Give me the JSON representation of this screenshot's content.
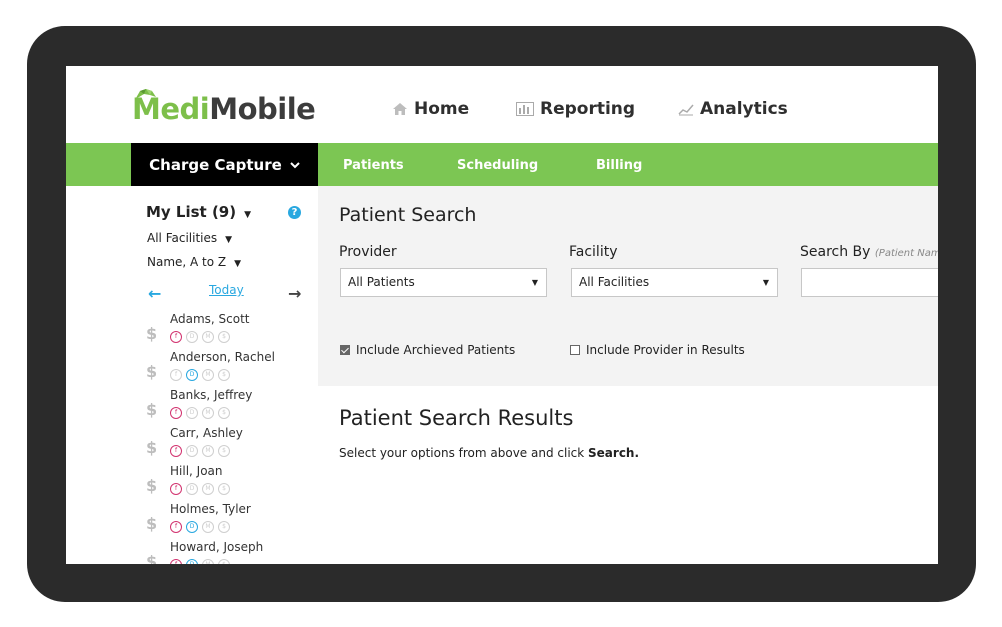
{
  "logo": {
    "part1": "Medi",
    "part2": "Mobile"
  },
  "top_nav": [
    {
      "label": "Home",
      "icon": "home-icon"
    },
    {
      "label": "Reporting",
      "icon": "bar-chart-icon"
    },
    {
      "label": "Analytics",
      "icon": "line-chart-icon"
    }
  ],
  "green_nav": {
    "active": "Charge Capture",
    "items": [
      "Patients",
      "Scheduling",
      "Billing"
    ]
  },
  "sidebar": {
    "mylist": "My List (9)",
    "facility_filter": "All Facilities",
    "sort_filter": "Name, A to Z",
    "today": "Today",
    "patients": [
      {
        "name": "Adams, Scott",
        "badges": [
          "f",
          "d",
          "m",
          "s"
        ],
        "active": [
          0
        ]
      },
      {
        "name": "Anderson, Rachel",
        "badges": [
          "f",
          "d",
          "m",
          "s"
        ],
        "active": [
          1
        ]
      },
      {
        "name": "Banks, Jeffrey",
        "badges": [
          "f",
          "d",
          "m",
          "s"
        ],
        "active": [
          0
        ]
      },
      {
        "name": "Carr, Ashley",
        "badges": [
          "f",
          "d",
          "m",
          "s"
        ],
        "active": [
          0
        ]
      },
      {
        "name": "Hill, Joan",
        "badges": [
          "f",
          "d",
          "m",
          "s"
        ],
        "active": [
          0
        ]
      },
      {
        "name": "Holmes, Tyler",
        "badges": [
          "f",
          "d",
          "m",
          "s"
        ],
        "active": [
          0,
          1
        ]
      },
      {
        "name": "Howard, Joseph",
        "badges": [
          "f",
          "d",
          "m",
          "s"
        ],
        "active": [
          0,
          1
        ]
      }
    ]
  },
  "search": {
    "title": "Patient Search",
    "provider_label": "Provider",
    "provider_value": "All Patients",
    "facility_label": "Facility",
    "facility_value": "All Facilities",
    "searchby_label": "Search By",
    "searchby_hint": "(Patient Name",
    "check_archived": "Include Archieved Patients",
    "check_provider": "Include Provider in Results",
    "archived_checked": true,
    "provider_checked": false
  },
  "results": {
    "title": "Patient Search Results",
    "text": "Select your options from above and click ",
    "text_bold": "Search."
  },
  "colors": {
    "green": "#7cc653",
    "blue": "#29a8e0",
    "pink": "#d2336f",
    "black": "#000000"
  }
}
